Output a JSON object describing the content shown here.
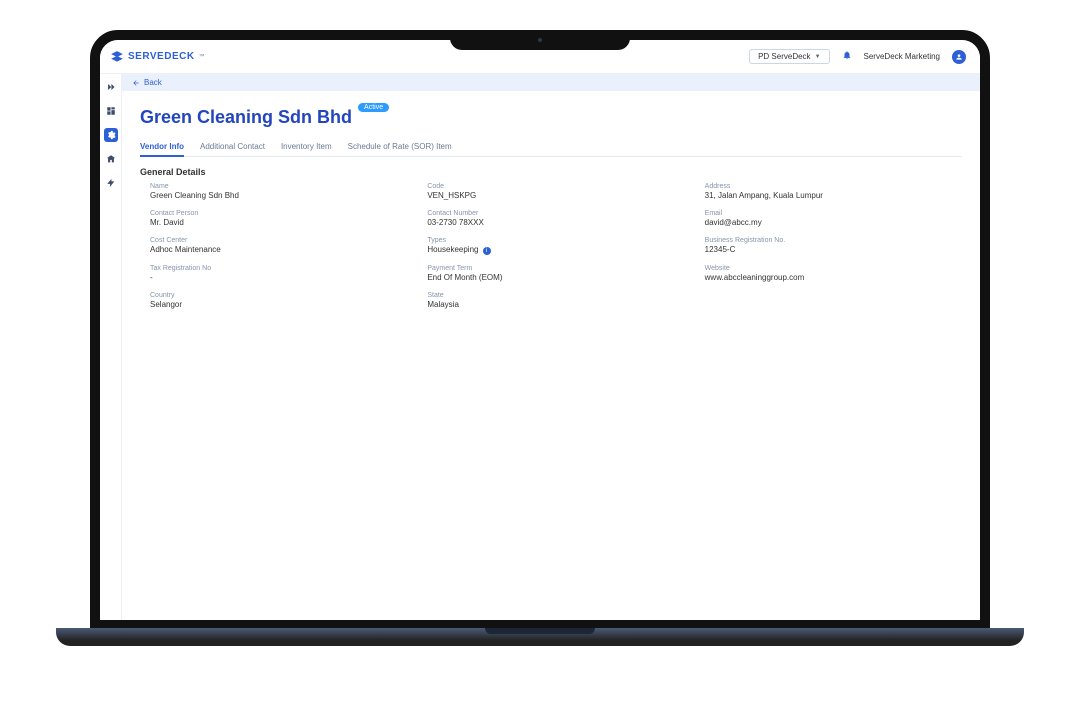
{
  "brand": {
    "name": "SERVEDECK",
    "mark": "™"
  },
  "topbar": {
    "org_button": "PD ServeDeck",
    "user_name": "ServeDeck Marketing"
  },
  "back": {
    "label": "Back"
  },
  "page": {
    "title": "Green Cleaning Sdn Bhd",
    "status_badge": "Active"
  },
  "tabs": [
    {
      "label": "Vendor Info"
    },
    {
      "label": "Additional Contact"
    },
    {
      "label": "Inventory Item"
    },
    {
      "label": "Schedule of Rate (SOR) Item"
    }
  ],
  "section": {
    "title": "General Details"
  },
  "details": {
    "name": {
      "label": "Name",
      "value": "Green Cleaning Sdn Bhd"
    },
    "code": {
      "label": "Code",
      "value": "VEN_HSKPG"
    },
    "address": {
      "label": "Address",
      "value": "31, Jalan Ampang, Kuala Lumpur"
    },
    "contact_person": {
      "label": "Contact Person",
      "value": "Mr. David"
    },
    "contact_number": {
      "label": "Contact Number",
      "value": "03-2730 78XXX"
    },
    "email": {
      "label": "Email",
      "value": "david@abcc.my"
    },
    "cost_center": {
      "label": "Cost Center",
      "value": "Adhoc Maintenance"
    },
    "types": {
      "label": "Types",
      "value": "Housekeeping"
    },
    "business_reg": {
      "label": "Business Registration No.",
      "value": "12345-C"
    },
    "tax_reg": {
      "label": "Tax Registration No",
      "value": "-"
    },
    "payment_term": {
      "label": "Payment Term",
      "value": "End Of Month (EOM)"
    },
    "website": {
      "label": "Website",
      "value": "www.abccleaninggroup.com"
    },
    "country": {
      "label": "Country",
      "value": "Selangor"
    },
    "state": {
      "label": "State",
      "value": "Malaysia"
    }
  },
  "sidebar": {
    "items": [
      {
        "name": "expand"
      },
      {
        "name": "dashboard"
      },
      {
        "name": "settings"
      },
      {
        "name": "building"
      },
      {
        "name": "bolt"
      }
    ]
  }
}
